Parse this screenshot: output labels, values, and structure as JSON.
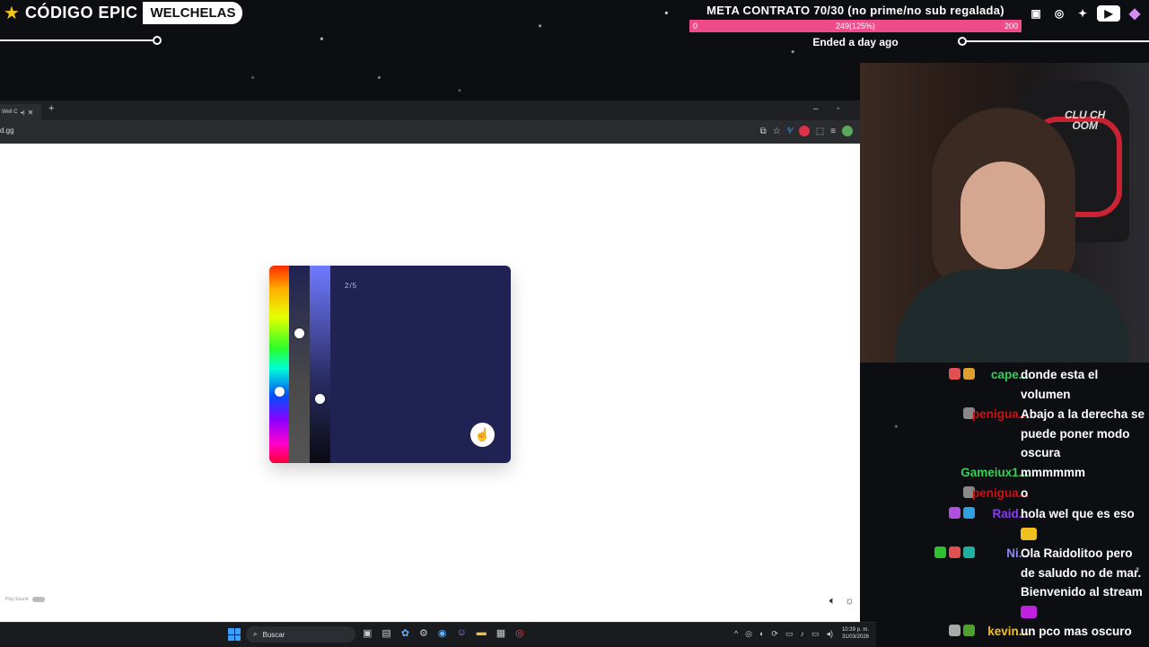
{
  "overlay": {
    "brand_name": "CÓDIGO EPIC",
    "brand_box": "WELCHELAS",
    "goal": {
      "title": "META CONTRATO 70/30 (no prime/no sub regalada)",
      "min": "0",
      "max": "200",
      "value_label": "249(125%)",
      "progress": 1.0,
      "status": "Ended a day ago"
    },
    "socials": [
      "twitch-icon",
      "instagram-icon",
      "twitter-icon",
      "youtube-icon",
      "gem-icon"
    ],
    "colors": {
      "goal_bar": "#ee4b8a",
      "brand_star": "#f5c518"
    }
  },
  "browser": {
    "tab_title": "Well C",
    "url": "d.gg",
    "page": {
      "counter": "2/5",
      "footer_label": "Play Sound",
      "colors": {
        "card": "#1f2252"
      }
    }
  },
  "taskbar": {
    "search_placeholder": "Buscar",
    "clock_time": "10:39 p. m.",
    "clock_date": "31/03/2026"
  },
  "chat": {
    "messages": [
      {
        "user": "cape...",
        "color": "#36d05a",
        "badges": [
          "#e05050",
          "#e0a030"
        ],
        "text": "donde esta el volumen"
      },
      {
        "user": "penigua...",
        "color": "#d01010",
        "badges": [
          "#888888"
        ],
        "text": "Abajo a la derecha se puede poner modo oscura"
      },
      {
        "user": "Gameiux1...",
        "color": "#36d05a",
        "badges": [],
        "text": "mmmmmm"
      },
      {
        "user": "penigua...",
        "color": "#d01010",
        "badges": [
          "#888888"
        ],
        "text": "o"
      },
      {
        "user": "Raid...",
        "color": "#8a3cf0",
        "badges": [
          "#b050e0",
          "#30a0e0"
        ],
        "text": "hola wel que es eso"
      },
      {
        "user": "Ni...",
        "color": "#8a8af0",
        "badges": [
          "#30c030",
          "#e05050",
          "#20b0a0"
        ],
        "text": "Ola Raidolitoo pero de saludo no de mar. Bienvenido al stream"
      },
      {
        "user": "kevin...",
        "color": "#f0c020",
        "badges": [
          "#aaaaaa",
          "#50a030"
        ],
        "text": "un pco mas oscuro"
      }
    ]
  }
}
